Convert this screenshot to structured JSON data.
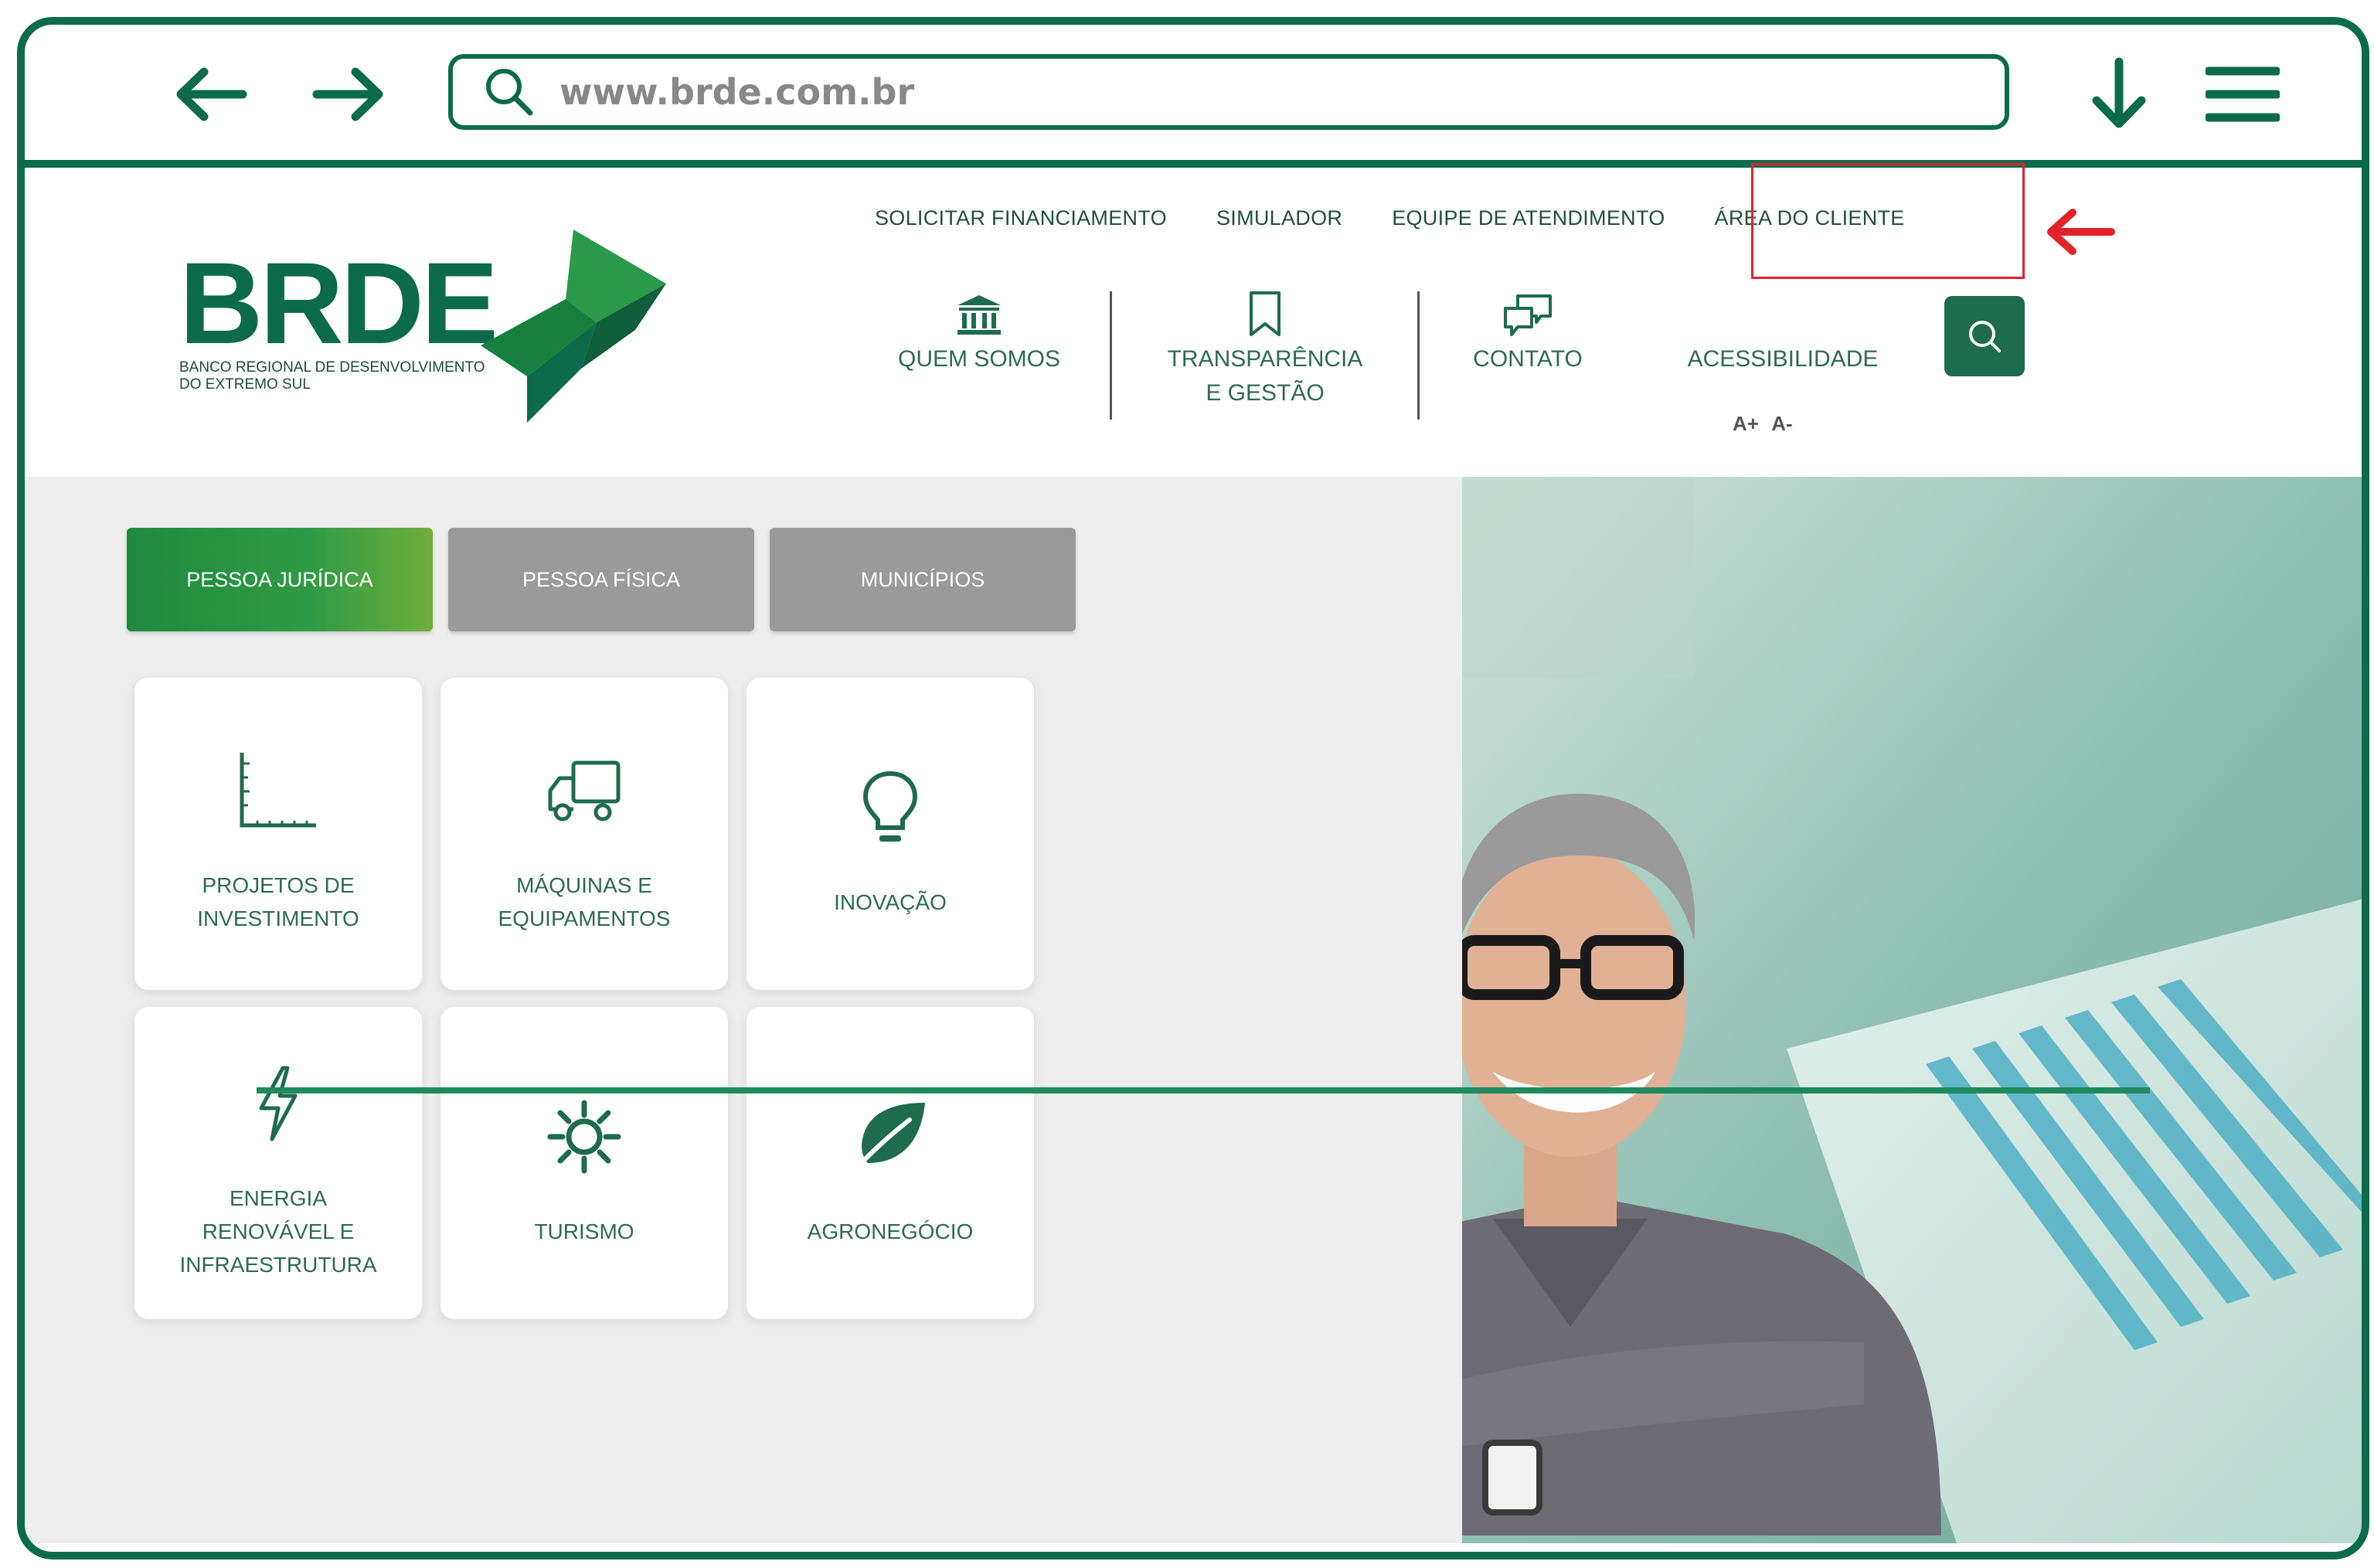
{
  "browser": {
    "url": "www.brde.com.br",
    "back_icon": "arrow-left-icon",
    "forward_icon": "arrow-right-icon",
    "download_icon": "arrow-down-icon",
    "menu_icon": "hamburger-menu-icon"
  },
  "site": {
    "logo": {
      "wordmark": "BRDE",
      "subtitle_line1": "BANCO REGIONAL DE DESENVOLVIMENTO",
      "subtitle_line2": "DO EXTREMO SUL"
    },
    "top_links": [
      "SOLICITAR FINANCIAMENTO",
      "SIMULADOR",
      "EQUIPE DE ATENDIMENTO",
      "ÁREA DO CLIENTE"
    ],
    "highlighted_link": "ÁREA DO CLIENTE",
    "main_nav": {
      "quem_somos": "QUEM SOMOS",
      "transparencia_line1": "TRANSPARÊNCIA",
      "transparencia_line2": "E GESTÃO",
      "contato": "CONTATO",
      "acessibilidade": "ACESSIBILIDADE"
    },
    "font_size_controls": {
      "increase": "A+",
      "decrease": "A-"
    }
  },
  "tabs": [
    {
      "label": "PESSOA JURÍDICA",
      "active": true
    },
    {
      "label": "PESSOA FÍSICA",
      "active": false
    },
    {
      "label": "MUNICÍPIOS",
      "active": false
    }
  ],
  "cards": [
    {
      "line1": "PROJETOS DE",
      "line2": "INVESTIMENTO",
      "line3": "",
      "icon": "chart-axes-icon"
    },
    {
      "line1": "MÁQUINAS E",
      "line2": "EQUIPAMENTOS",
      "line3": "",
      "icon": "truck-icon"
    },
    {
      "line1": "INOVAÇÃO",
      "line2": "",
      "line3": "",
      "icon": "lightbulb-icon"
    },
    {
      "line1": "ENERGIA",
      "line2": "RENOVÁVEL E",
      "line3": "INFRAESTRUTURA",
      "icon": "lightning-icon"
    },
    {
      "line1": "TURISMO",
      "line2": "",
      "line3": "",
      "icon": "sun-icon"
    },
    {
      "line1": "AGRONEGÓCIO",
      "line2": "",
      "line3": "",
      "icon": "leaf-icon"
    }
  ],
  "colors": {
    "brand_green": "#0b6b4b",
    "accent_green": "#1f8a3e",
    "highlight_red": "#e2232a",
    "tab_inactive": "#9a9a9a"
  }
}
